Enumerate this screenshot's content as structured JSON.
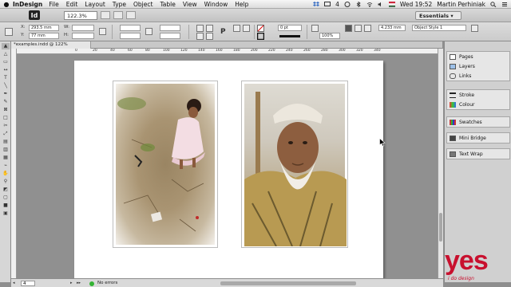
{
  "menu": {
    "app_name": "InDesign",
    "items": [
      "File",
      "Edit",
      "Layout",
      "Type",
      "Object",
      "Table",
      "View",
      "Window",
      "Help"
    ],
    "tray_count": "4",
    "clock": "Wed 19:52",
    "user": "Martin Perhiniak"
  },
  "appbar": {
    "logo": "Id",
    "zoom": "122.3%",
    "workspace": "Essentials",
    "workspace_arrow": "▾"
  },
  "control": {
    "x_value": "293.5 mm",
    "y_value": "77 mm",
    "x_label": "X:",
    "y_label": "Y:",
    "w_label": "W:",
    "h_label": "H:",
    "stroke_weight": "0 pt",
    "opacity": "100%",
    "measure": "4.233 mm",
    "object_style": "Object Style 1",
    "p_glyph": "P"
  },
  "document": {
    "tab_title": "*examples.indd @ 122%"
  },
  "ruler": {
    "labels": [
      "0",
      "20",
      "40",
      "60",
      "80",
      "100",
      "120",
      "140",
      "160",
      "180",
      "200",
      "220",
      "240",
      "260",
      "280",
      "300",
      "320",
      "340"
    ]
  },
  "panels": {
    "group1": [
      "Pages",
      "Layers",
      "Links"
    ],
    "group2": [
      "Stroke",
      "Colour"
    ],
    "group3": [
      "Swatches"
    ],
    "group4": [
      "Mini Bridge"
    ],
    "group5": [
      "Text Wrap"
    ]
  },
  "status": {
    "page_number": "4",
    "errors": "No errors"
  },
  "watermark": {
    "text": "yes",
    "subtext": "i do design"
  },
  "colors": {
    "accent_red": "#c8102e",
    "status_green": "#33b333"
  }
}
